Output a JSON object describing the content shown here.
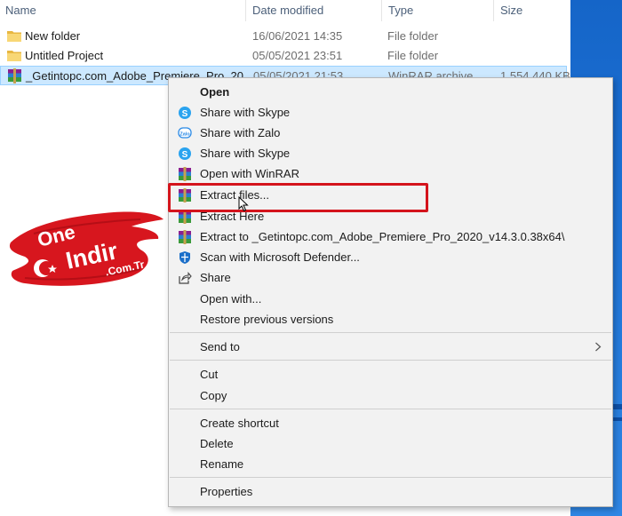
{
  "columns": {
    "name": "Name",
    "date": "Date modified",
    "type": "Type",
    "size": "Size"
  },
  "files": [
    {
      "name": "New folder",
      "date": "16/06/2021 14:35",
      "type": "File folder",
      "size": "",
      "icon": "folder-icon"
    },
    {
      "name": "Untitled Project",
      "date": "05/05/2021 23:51",
      "type": "File folder",
      "size": "",
      "icon": "folder-icon"
    },
    {
      "name": "_Getintopc.com_Adobe_Premiere_Pro_20...",
      "date": "05/05/2021 21:53",
      "type": "WinRAR archive",
      "size": "1,554,440 KB",
      "icon": "winrar-icon"
    }
  ],
  "context_menu": {
    "items": [
      {
        "label": "Open",
        "icon": "",
        "bold": true
      },
      {
        "label": "Share with Skype",
        "icon": "skype-icon"
      },
      {
        "label": "Share with Zalo",
        "icon": "zalo-icon"
      },
      {
        "label": "Share with Skype",
        "icon": "skype-icon"
      },
      {
        "label": "Open with WinRAR",
        "icon": "winrar-icon"
      },
      {
        "label": "Extract files...",
        "icon": "winrar-icon",
        "highlighted": true
      },
      {
        "label": "Extract Here",
        "icon": "winrar-icon"
      },
      {
        "label": "Extract to _Getintopc.com_Adobe_Premiere_Pro_2020_v14.3.0.38x64\\",
        "icon": "winrar-icon"
      },
      {
        "label": "Scan with Microsoft Defender...",
        "icon": "defender-icon"
      },
      {
        "label": "Share",
        "icon": "share-icon"
      },
      {
        "label": "Open with...",
        "icon": ""
      },
      {
        "label": "Restore previous versions",
        "icon": ""
      },
      {
        "label": "Send to",
        "icon": "",
        "submenu": true
      },
      {
        "label": "Cut",
        "icon": ""
      },
      {
        "label": "Copy",
        "icon": ""
      },
      {
        "label": "Create shortcut",
        "icon": ""
      },
      {
        "label": "Delete",
        "icon": ""
      },
      {
        "label": "Rename",
        "icon": ""
      },
      {
        "label": "Properties",
        "icon": ""
      }
    ]
  },
  "watermark": {
    "line1": "One",
    "line2": "Indir",
    "line3": ".Com.Tr"
  },
  "colors": {
    "selection": "#cce8ff",
    "highlight_border": "#d4141c",
    "menu_bg": "#f2f2f2",
    "taskbar_blue": "#1e73d6",
    "logo_red": "#d7161e"
  }
}
